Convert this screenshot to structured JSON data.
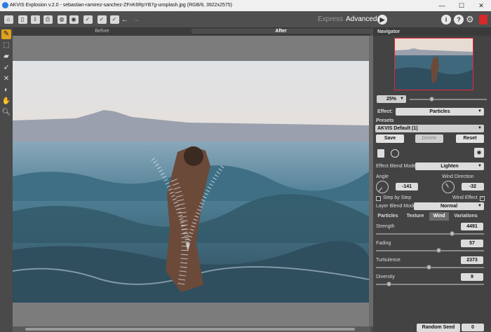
{
  "window": {
    "title": "AKVIS Explosion v.2.0 - sebastian-ramirez-sanchez-ZFnK6RpYB7g-unsplash.jpg (RGB/8, 3922x2575)"
  },
  "toolbar": {
    "express": "Express",
    "advanced": "Advanced"
  },
  "view": {
    "before": "Before",
    "after": "After"
  },
  "navigator": {
    "title": "Navigator",
    "zoom": "25%"
  },
  "effect": {
    "label": "Effect:",
    "value": "Particles"
  },
  "presets": {
    "label": "Presets",
    "value": "AKVIS Default (1)",
    "save": "Save",
    "delete": "Delete",
    "reset": "Reset"
  },
  "blend": {
    "effect_label": "Effect Blend Mode",
    "effect_value": "Lighten",
    "layer_label": "Layer Blend Mode",
    "layer_value": "Normal"
  },
  "angle": {
    "label": "Angle",
    "value": "-141",
    "dir_label": "Wind Direction",
    "dir_value": "-32"
  },
  "checks": {
    "step": "Step by Step",
    "wind": "Wind Effect",
    "step_checked": false,
    "wind_checked": true
  },
  "tabs": [
    "Particles",
    "Texture",
    "Wind",
    "Variations"
  ],
  "active_tab": "Wind",
  "params": [
    {
      "label": "Strength",
      "value": "4491",
      "level": 0.7
    },
    {
      "label": "Fading",
      "value": "57",
      "level": 0.57
    },
    {
      "label": "Turbulence",
      "value": "2373",
      "level": 0.48
    },
    {
      "label": "Diversity",
      "value": "9",
      "level": 0.1
    }
  ],
  "seed": {
    "label": "Random Seed",
    "value": "0"
  }
}
